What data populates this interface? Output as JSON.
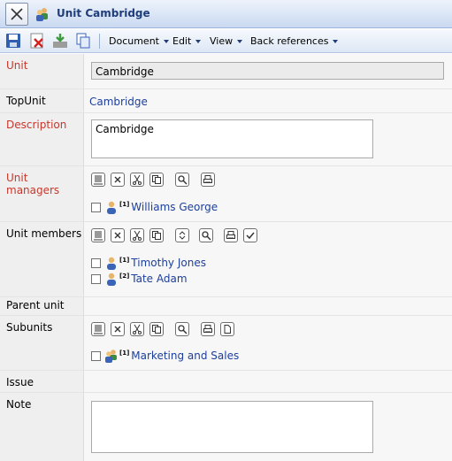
{
  "window": {
    "title": "Unit Cambridge"
  },
  "toolbar": {
    "icons": [
      "save-icon",
      "delete-icon",
      "download-icon",
      "copy-icon"
    ],
    "menus": [
      "Document",
      "Edit",
      "View",
      "Back references"
    ]
  },
  "form": {
    "unit": {
      "label": "Unit",
      "value": "Cambridge"
    },
    "top_unit": {
      "label": "TopUnit",
      "value": "Cambridge"
    },
    "description": {
      "label": "Description",
      "value": "Cambridge"
    },
    "unit_managers": {
      "label": "Unit managers",
      "items": [
        {
          "index": "[1]",
          "name": "Williams George"
        }
      ]
    },
    "unit_members": {
      "label": "Unit members",
      "items": [
        {
          "index": "[1]",
          "name": "Timothy Jones"
        },
        {
          "index": "[2]",
          "name": "Tate Adam"
        }
      ]
    },
    "parent_unit": {
      "label": "Parent unit"
    },
    "subunits": {
      "label": "Subunits",
      "items": [
        {
          "index": "[1]",
          "name": "Marketing and Sales"
        }
      ]
    },
    "issue": {
      "label": "Issue"
    },
    "note": {
      "label": "Note",
      "value": ""
    }
  },
  "colors": {
    "required_label": "#c8372b",
    "link": "#1d3f9b",
    "title": "#1f3d7a"
  }
}
